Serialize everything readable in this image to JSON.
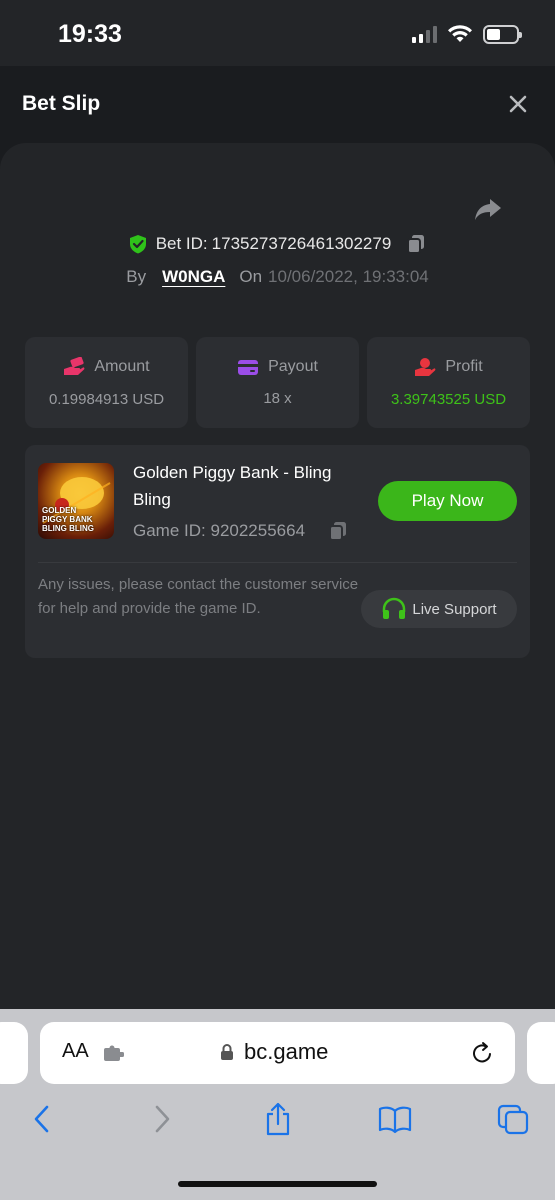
{
  "status_bar": {
    "time": "19:33"
  },
  "header": {
    "title": "Bet Slip"
  },
  "bet": {
    "id_label": "Bet ID:",
    "id_value": "1735273726461302279",
    "by_label": "By",
    "user": "W0NGA",
    "on_label": "On",
    "datetime": "10/06/2022, 19:33:04"
  },
  "stats": {
    "amount_label": "Amount",
    "amount_value": "0.19984913 USD",
    "payout_label": "Payout",
    "payout_value": "18 x",
    "profit_label": "Profit",
    "profit_value": "3.39743525 USD"
  },
  "game": {
    "title": "Golden Piggy Bank - Bling Bling",
    "id_label": "Game ID:",
    "id_value": "9202255664",
    "thumb_text": "GOLDEN PIGGY BANK BLING BLING",
    "play_label": "Play Now"
  },
  "support": {
    "text": "Any issues, please contact the customer service for help and provide the game ID.",
    "button_label": "Live Support"
  },
  "browser": {
    "aa_label": "AA",
    "url": "bc.game"
  },
  "colors": {
    "accent_green": "#3bb61a",
    "profit_green": "#3ec219",
    "verified_green": "#2fc21a"
  },
  "icons": [
    "shield-check-icon",
    "copy-icon",
    "share-icon",
    "close-icon",
    "money-hand-icon",
    "wallet-card-icon",
    "profit-hand-icon",
    "headset-icon",
    "lock-icon",
    "reload-icon",
    "back-icon",
    "forward-icon",
    "share-sheet-icon",
    "bookmarks-icon",
    "tabs-icon",
    "extension-icon"
  ]
}
